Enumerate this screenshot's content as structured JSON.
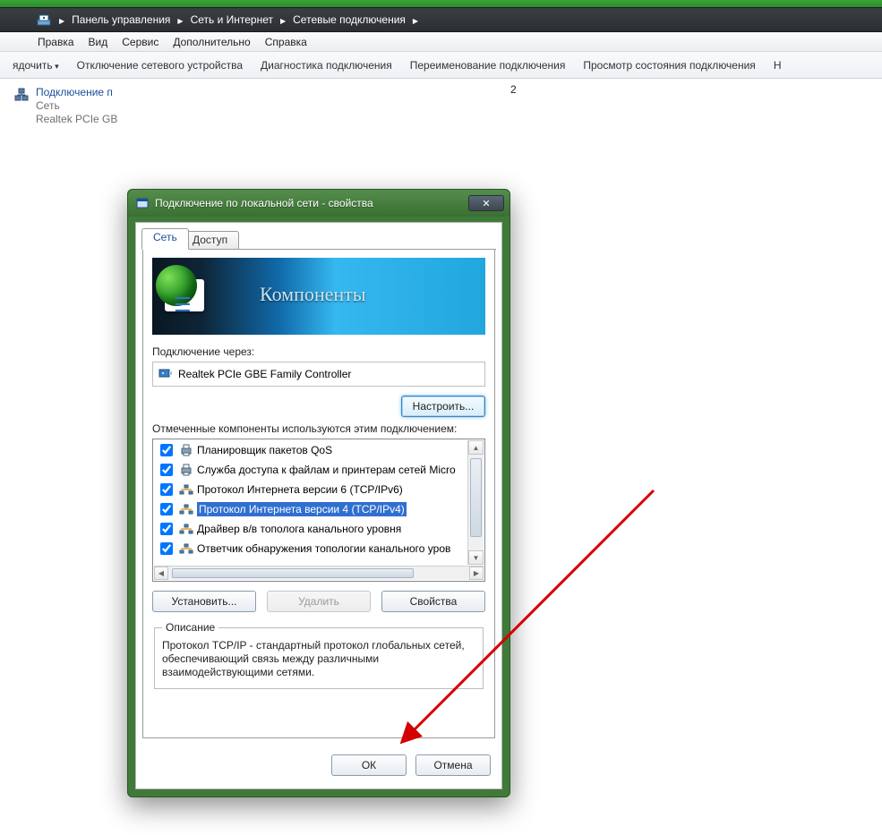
{
  "breadcrumb": {
    "items": [
      "Панель управления",
      "Сеть и Интернет",
      "Сетевые подключения"
    ]
  },
  "menubar": {
    "items": [
      "Правка",
      "Вид",
      "Сервис",
      "Дополнительно",
      "Справка"
    ]
  },
  "cmdbar": {
    "items": [
      "ядочить",
      "Отключение сетевого устройства",
      "Диагностика подключения",
      "Переименование подключения",
      "Просмотр состояния подключения",
      "Н"
    ]
  },
  "connections": {
    "tile": {
      "name": "Подключение п",
      "status": "Сеть",
      "device": "Realtek PCIe GB"
    },
    "stray_fragment": "2"
  },
  "dialog": {
    "title": "Подключение по локальной сети - свойства",
    "tabs": [
      "Сеть",
      "Доступ"
    ],
    "banner": "Компоненты",
    "section": {
      "connect_through": "Подключение через:",
      "adapter": "Realtek PCIe GBE Family Controller",
      "configure_btn": "Настроить...",
      "checked_label": "Отмеченные компоненты используются этим подключением:"
    },
    "components": [
      {
        "checked": true,
        "label": "Планировщик пакетов QoS",
        "selected": false,
        "icon": "printer"
      },
      {
        "checked": true,
        "label": "Служба доступа к файлам и принтерам сетей Micro",
        "selected": false,
        "icon": "printer"
      },
      {
        "checked": true,
        "label": "Протокол Интернета версии 6 (TCP/IPv6)",
        "selected": false,
        "icon": "net"
      },
      {
        "checked": true,
        "label": "Протокол Интернета версии 4 (TCP/IPv4)",
        "selected": true,
        "icon": "net"
      },
      {
        "checked": true,
        "label": "Драйвер в/в тополога канального уровня",
        "selected": false,
        "icon": "net"
      },
      {
        "checked": true,
        "label": "Ответчик обнаружения топологии канального уров",
        "selected": false,
        "icon": "net"
      }
    ],
    "buttons": {
      "install": "Установить...",
      "remove": "Удалить",
      "properties": "Свойства"
    },
    "description": {
      "legend": "Описание",
      "text": "Протокол TCP/IP - стандартный протокол глобальных сетей, обеспечивающий связь между различными взаимодействующими сетями."
    },
    "footer": {
      "ok": "ОК",
      "cancel": "Отмена"
    }
  }
}
